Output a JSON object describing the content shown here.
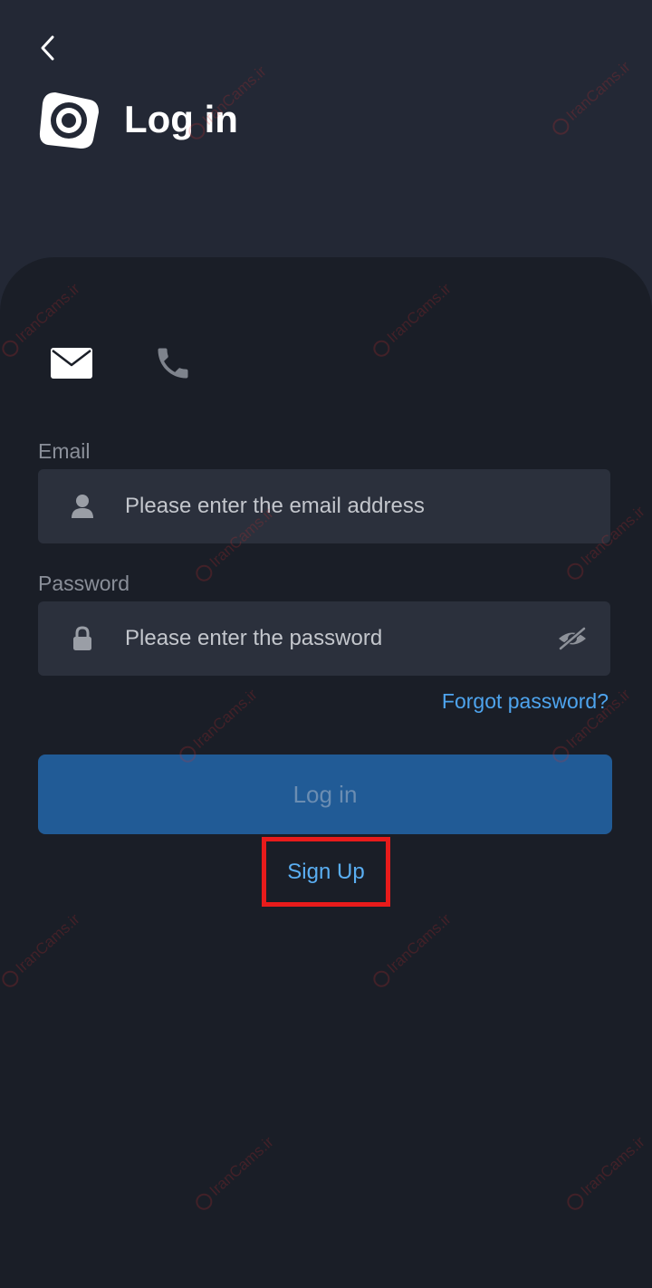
{
  "header": {
    "title": "Log in",
    "back_icon": "chevron-left-icon",
    "logo_icon": "app-logo-icon"
  },
  "login_modes": [
    {
      "name": "email",
      "icon": "mail-icon",
      "active": true
    },
    {
      "name": "phone",
      "icon": "phone-icon",
      "active": false
    }
  ],
  "form": {
    "email_label": "Email",
    "email_placeholder": "Please enter the email address",
    "email_value": "",
    "password_label": "Password",
    "password_placeholder": "Please enter the password",
    "password_value": "",
    "forgot_label": "Forgot password?",
    "login_label": "Log in",
    "signup_label": "Sign Up"
  },
  "watermark": "IranCams.ir",
  "colors": {
    "background": "#232835",
    "card": "#1a1e27",
    "field": "#2b303c",
    "accent": "#4ea4ee",
    "button": "#215b96",
    "highlight": "#e81b1b"
  }
}
